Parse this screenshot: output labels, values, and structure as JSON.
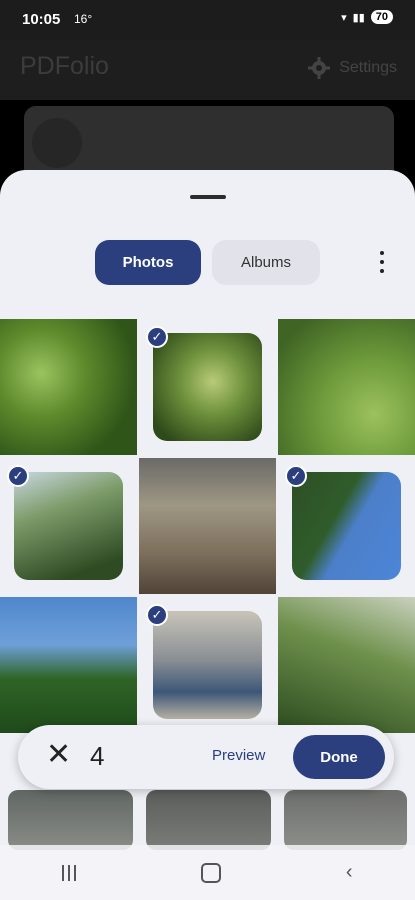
{
  "status_bar": {
    "time": "10:05",
    "temperature": "16°",
    "battery": "70"
  },
  "app_bar": {
    "title": "PDFolio",
    "settings_label": "Settings"
  },
  "picker": {
    "tabs": [
      {
        "label": "Photos",
        "selected": true
      },
      {
        "label": "Albums",
        "selected": false
      }
    ],
    "photos": [
      {
        "selected": false
      },
      {
        "selected": true
      },
      {
        "selected": false
      },
      {
        "selected": true
      },
      {
        "selected": false
      },
      {
        "selected": true
      },
      {
        "selected": false
      },
      {
        "selected": true
      },
      {
        "selected": false
      }
    ]
  },
  "selection_bar": {
    "count": "4",
    "preview_label": "Preview",
    "done_label": "Done"
  },
  "icons": {
    "close": "close-icon",
    "more": "more-vert-icon",
    "settings": "gear-icon",
    "check": "check-icon"
  },
  "colors": {
    "accent": "#2b3f7f",
    "sheet_bg": "#eff0f5"
  }
}
